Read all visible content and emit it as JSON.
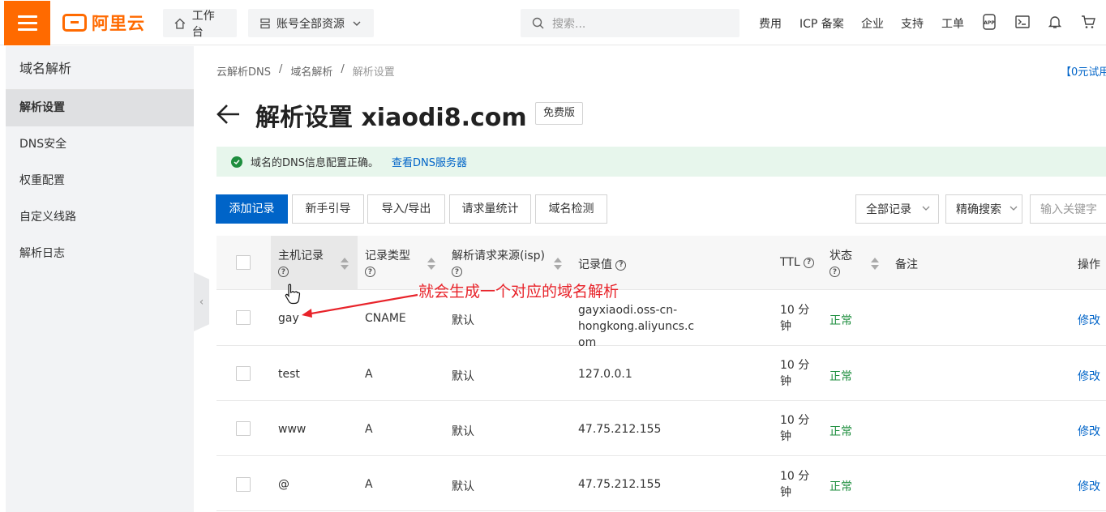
{
  "topbar": {
    "brand": "阿里云",
    "workbench": "工作台",
    "resources": "账号全部资源",
    "search_placeholder": "搜索...",
    "links": [
      "费用",
      "ICP 备案",
      "企业",
      "支持",
      "工单"
    ]
  },
  "sidebar": {
    "title": "域名解析",
    "items": [
      {
        "label": "解析设置",
        "active": true
      },
      {
        "label": "DNS安全"
      },
      {
        "label": "权重配置"
      },
      {
        "label": "自定义线路"
      },
      {
        "label": "解析日志"
      }
    ]
  },
  "breadcrumb": [
    "云解析DNS",
    "域名解析",
    "解析设置"
  ],
  "trial_link": "【0元试用",
  "page": {
    "title": "解析设置 xiaodi8.com",
    "badge": "免费版"
  },
  "alert": {
    "message": "域名的DNS信息配置正确。",
    "link": "查看DNS服务器"
  },
  "toolbar": {
    "add": "添加记录",
    "guide": "新手引导",
    "import_export": "导入/导出",
    "stats": "请求量统计",
    "check": "域名检测",
    "filter_records": "全部记录",
    "search_mode": "精确搜索",
    "keyword_placeholder": "输入关键字"
  },
  "table": {
    "headers": {
      "host": "主机记录",
      "type": "记录类型",
      "line": "解析请求来源(isp)",
      "value": "记录值",
      "ttl": "TTL",
      "status": "状态",
      "remark": "备注",
      "action": "操作"
    },
    "rows": [
      {
        "host": "gay",
        "type": "CNAME",
        "line": "默认",
        "value": "gayxiaodi.oss-cn-hongkong.aliyuncs.com",
        "value_line1": "gayxiaodi.oss-cn-hongkong.aliyuncs.c",
        "value_line2": "om",
        "ttl1": "10 分",
        "ttl2": "钟",
        "status": "正常",
        "action": "修改"
      },
      {
        "host": "test",
        "type": "A",
        "line": "默认",
        "value_line1": "127.0.0.1",
        "value_line2": "",
        "ttl1": "10 分",
        "ttl2": "钟",
        "status": "正常",
        "action": "修改"
      },
      {
        "host": "www",
        "type": "A",
        "line": "默认",
        "value_line1": "47.75.212.155",
        "value_line2": "",
        "ttl1": "10 分",
        "ttl2": "钟",
        "status": "正常",
        "action": "修改"
      },
      {
        "host": "@",
        "type": "A",
        "line": "默认",
        "value_line1": "47.75.212.155",
        "value_line2": "",
        "ttl1": "10 分",
        "ttl2": "钟",
        "status": "正常",
        "action": "修改"
      }
    ]
  },
  "annotation": "就会生成一个对应的域名解析",
  "colors": {
    "brand": "#ff6a00",
    "primary": "#0064c8",
    "success": "#1e8e3e",
    "annotation": "#e8232a"
  }
}
